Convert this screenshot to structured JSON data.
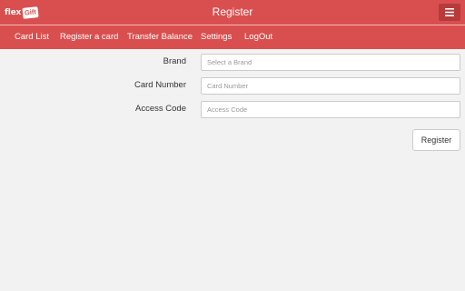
{
  "header": {
    "logo_text": "flex",
    "logo_badge": "Gift",
    "title": "Register",
    "menu_icon": "hamburger-icon"
  },
  "nav": {
    "items": [
      {
        "label": "Card List"
      },
      {
        "label": "Register a card"
      },
      {
        "label": "Transfer Balance"
      },
      {
        "label": "Settings"
      },
      {
        "label": "LogOut"
      }
    ]
  },
  "form": {
    "brand": {
      "label": "Brand",
      "placeholder": "Select a Brand",
      "value": ""
    },
    "card_number": {
      "label": "Card Number",
      "placeholder": "Card Number",
      "value": ""
    },
    "access_code": {
      "label": "Access Code",
      "placeholder": "Access Code",
      "value": ""
    },
    "submit_label": "Register"
  },
  "colors": {
    "accent": "#d94f4f",
    "accent_dark": "#b73b3b",
    "background": "#f2f2f2"
  }
}
